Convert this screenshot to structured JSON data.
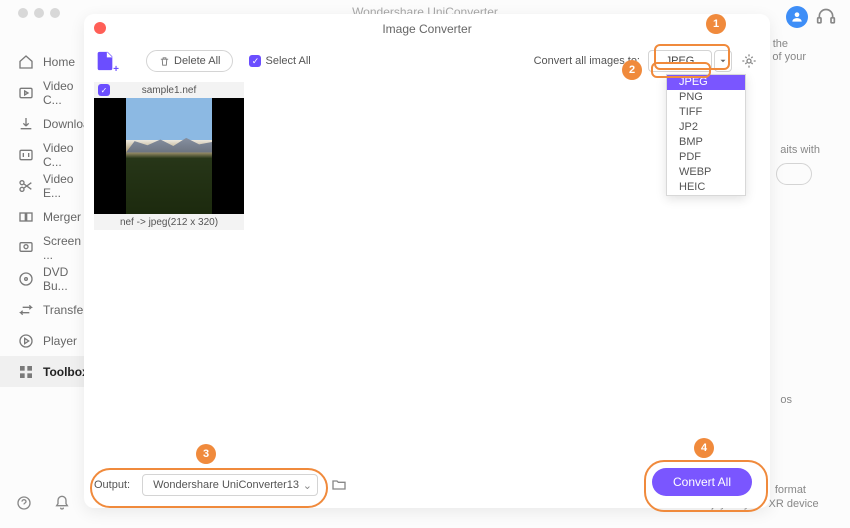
{
  "app": {
    "title": "Wondershare UniConverter"
  },
  "topicons": {
    "avatar_glyph": "⍰"
  },
  "sidebar": {
    "items": [
      {
        "label": "Home",
        "icon": "home"
      },
      {
        "label": "Video C...",
        "icon": "video-converter"
      },
      {
        "label": "Downloa...",
        "icon": "download"
      },
      {
        "label": "Video C...",
        "icon": "video-compressor"
      },
      {
        "label": "Video E...",
        "icon": "video-editor"
      },
      {
        "label": "Merger",
        "icon": "merger"
      },
      {
        "label": "Screen ...",
        "icon": "screen-recorder"
      },
      {
        "label": "DVD Bu...",
        "icon": "dvd-burner"
      },
      {
        "label": "Transfer",
        "icon": "transfer"
      },
      {
        "label": "Player",
        "icon": "player"
      },
      {
        "label": "Toolbox",
        "icon": "toolbox"
      }
    ]
  },
  "modal": {
    "title": "Image Converter",
    "delete_all": "Delete All",
    "select_all": "Select All",
    "convert_label": "Convert all images to:",
    "format_selected": "JPEG",
    "formats": [
      "JPEG",
      "PNG",
      "TIFF",
      "JP2",
      "BMP",
      "PDF",
      "WEBP",
      "HEIC"
    ],
    "output_label": "Output:",
    "output_value": "Wondershare UniConverter13",
    "convert_button": "Convert All"
  },
  "file": {
    "name": "sample1.nef",
    "conversion_info": "nef -> jpeg(212 x 320)"
  },
  "annotations": {
    "a1": "1",
    "a2": "2",
    "a3": "3",
    "a4": "4"
  },
  "bg_fragments": {
    "t1": "the",
    "t2": "of your",
    "t3": "aits with",
    "t4": "os",
    "t5": "format",
    "t6": "and enjoy on your XR device"
  }
}
